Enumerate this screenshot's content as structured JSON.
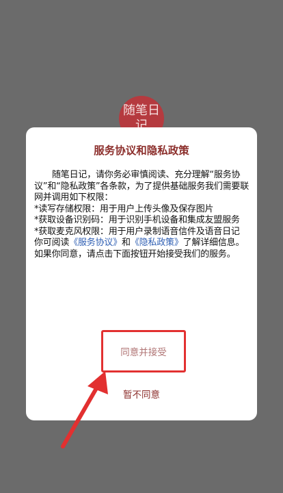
{
  "logo": {
    "text": "随笔日记"
  },
  "dialog": {
    "title": "服务协议和隐私政策",
    "intro": "随笔日记，请你务必审慎阅读、充分理解“服务协议”和“隐私政策”各条款，为了提供基础服务我们需要联网并调用如下权限：",
    "perm1": "*读写存储权限：用于用户上传头像及保存图片",
    "perm2": "*获取设备识别码：用于识别手机设备和集成友盟服务",
    "perm3": "*获取麦克风权限：用于用户录制语音信件及语音日记",
    "read_prefix": "你可阅读",
    "link_service": "《服务协议》",
    "and": "和",
    "link_privacy": "《隐私政策》",
    "read_suffix": "了解详细信息。如果你同意，请点击下面按钮开始接受我们的服务。",
    "agree_label": "同意并接受",
    "disagree_label": "暂不同意"
  },
  "colors": {
    "title": "#8c2f2c",
    "link": "#2f5fb3",
    "highlight": "#e23030",
    "overlay": "#6b6b6b"
  }
}
